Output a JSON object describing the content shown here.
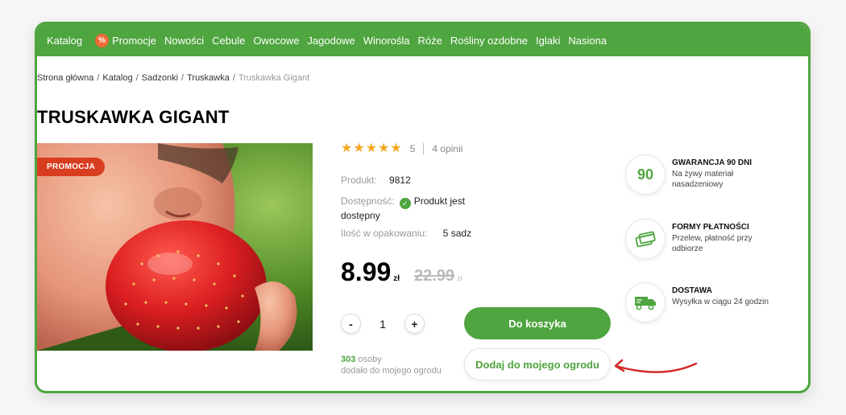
{
  "nav": {
    "items": [
      {
        "label": "Katalog"
      },
      {
        "label": "Promocje",
        "badge": "%"
      },
      {
        "label": "Nowości"
      },
      {
        "label": "Cebule"
      },
      {
        "label": "Owocowe"
      },
      {
        "label": "Jagodowe"
      },
      {
        "label": "Winorośla"
      },
      {
        "label": "Róże"
      },
      {
        "label": "Rośliny ozdobne"
      },
      {
        "label": "Iglaki"
      },
      {
        "label": "Nasiona"
      }
    ]
  },
  "breadcrumb": [
    "Strona główna",
    "Katalog",
    "Sadzonki",
    "Truskawka",
    "Truskawka Gigant"
  ],
  "product": {
    "title": "TRUSKAWKA GIGANT",
    "promo_label": "PROMOCJA",
    "rating": {
      "stars": 5,
      "score": "5",
      "reviews": "4 opinii"
    },
    "code_label": "Produkt:",
    "code_value": "9812",
    "availability_label": "Dostępność:",
    "availability_value_1": "Produkt jest",
    "availability_value_2": "dostępny",
    "pack_label": "Ilość w opakowaniu:",
    "pack_value": "5 sadz",
    "price": "8.99",
    "price_currency": "zł",
    "old_price": "22.99",
    "old_price_currency": "zł",
    "quantity": "1",
    "qty_minus": "-",
    "qty_plus": "+",
    "cart_button": "Do koszyka",
    "garden_button": "Dodaj do mojego ogrodu",
    "garden_count": "303",
    "garden_count_text_1": "osoby",
    "garden_count_text_2": "dodało do mojego ogrodu"
  },
  "features": [
    {
      "icon": "badge-90-icon",
      "icon_text": "90",
      "title": "GWARANCJA 90 DNI",
      "desc": "Na żywy materiał nasadzeniowy"
    },
    {
      "icon": "payment-cards-icon",
      "title": "FORMY PŁATNOŚCI",
      "desc": "Przelew, płatność przy odbiorze"
    },
    {
      "icon": "delivery-truck-icon",
      "title": "DOSTAWA",
      "desc": "Wysyłka w ciągu 24 godzin"
    }
  ],
  "colors": {
    "brand_green": "#4fa53f",
    "promo_red": "#d93d1f",
    "star": "#f5a623",
    "annotation_red": "#d42a2a"
  }
}
